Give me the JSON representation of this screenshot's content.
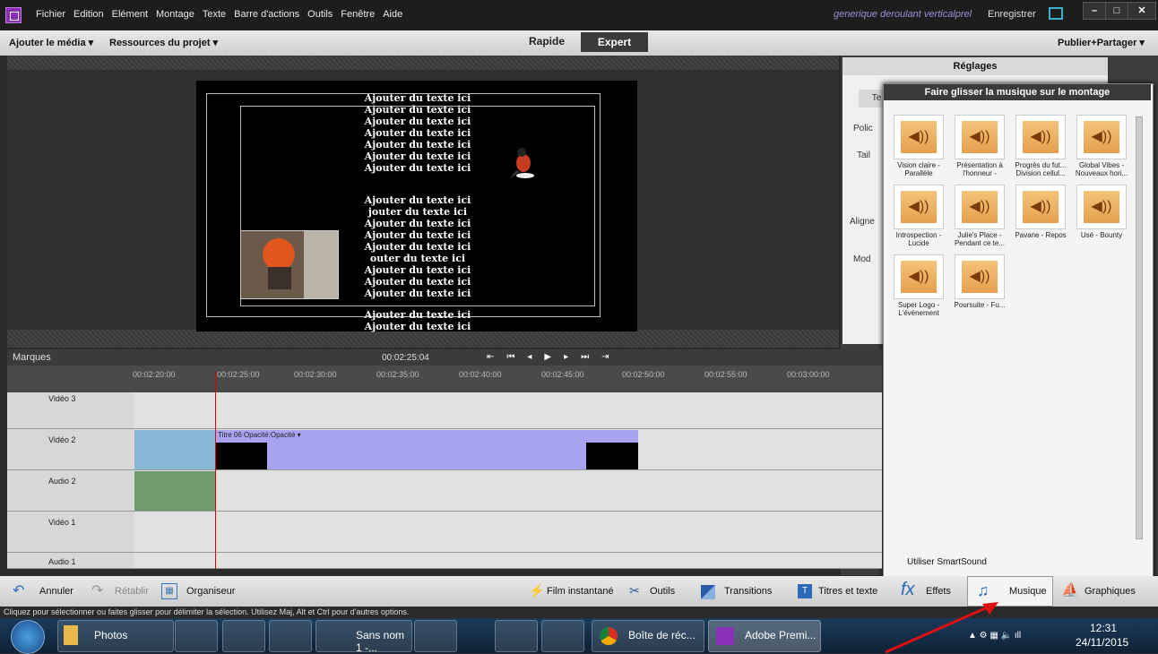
{
  "app": {
    "menu": [
      "Fichier",
      "Edition",
      "Elément",
      "Montage",
      "Texte",
      "Barre d'actions",
      "Outils",
      "Fenêtre",
      "Aide"
    ],
    "doc_title": "generique deroulant verticalprel",
    "save_label": "Enregistrer",
    "window_controls": [
      "–",
      "□",
      "✕"
    ]
  },
  "bar2": {
    "add_media": "Ajouter le média ▾",
    "project_assets": "Ressources du projet ▾",
    "mode_quick": "Rapide",
    "mode_expert": "Expert",
    "publish": "Publier+Partager ▾"
  },
  "monitor": {
    "title_lines_top": [
      "Ajouter du texte ici",
      "Ajouter du texte ici",
      "Ajouter du texte ici",
      "Ajouter du texte ici",
      "Ajouter du texte ici",
      "Ajouter du texte ici",
      "Ajouter du texte ici"
    ],
    "title_lines_mid": [
      "Ajouter du texte ici",
      "jouter du texte ici",
      "Ajouter du texte ici",
      "Ajouter du texte ici",
      "Ajouter du texte ici",
      "outer du texte ici",
      "Ajouter du texte ici",
      "Ajouter du texte ici",
      "Ajouter du texte ici"
    ],
    "title_lines_bottom": [
      "Ajouter du texte ici",
      "Ajouter du texte ici"
    ]
  },
  "settings_panel": {
    "title": "Réglages",
    "tab_partial": "Te",
    "labels": [
      "Polic",
      "Tail",
      "Aligne",
      "Mod"
    ]
  },
  "music_panel": {
    "title": "Faire glisser la musique sur le montage",
    "tracks": [
      "Vision claire - Parallèle",
      "Présentation à l'honneur -",
      "Progrès du fut... Division cellul...",
      "Global Vibes - Nouveaux hori...",
      "Introspection - Lucide",
      "Julie's Place - Pendant ce te...",
      "Pavane - Repos",
      "Usé - Bounty",
      "Super Logo - L'événement",
      "Poursuite - Fu..."
    ],
    "smartsound": "Utiliser SmartSound"
  },
  "timeline": {
    "markers": "Marques",
    "timecode": "00:02:25:04",
    "ticks": [
      "00:02:20:00",
      "00:02:25:00",
      "00:02:30:00",
      "00:02:35:00",
      "00:02:40:00",
      "00:02:45:00",
      "00:02:50:00",
      "00:02:55:00",
      "00:03:00:00"
    ],
    "tracks": [
      "Vidéo 3",
      "Vidéo 2",
      "Audio 2",
      "Vidéo 1",
      "Audio 1"
    ],
    "clip_label": "Titre 06  Opacité:Opacité ▾"
  },
  "toolbar": {
    "undo": "Annuler",
    "redo": "Rétablir",
    "organizer": "Organiseur",
    "instant_movie": "Film instantané",
    "tools": "Outils",
    "transitions": "Transitions",
    "titles": "Titres et texte",
    "effects": "Effets",
    "music": "Musique",
    "graphics": "Graphiques"
  },
  "status": "Cliquez pour sélectionner ou faites glisser pour délimiter la sélection. Utilisez Maj, Alt et Ctrl pour d'autres options.",
  "taskbar": {
    "items": [
      "Photos",
      "Sans nom 1 -...",
      "Boîte de réc...",
      "Adobe Premi..."
    ],
    "time": "12:31",
    "date": "24/11/2015"
  },
  "colors": {
    "accent_purple": "#8a2fb8",
    "clip_purple": "#a9a4f2",
    "arrow_red": "#e01010"
  }
}
